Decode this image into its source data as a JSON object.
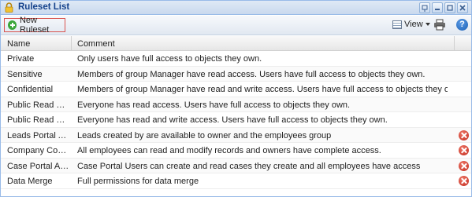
{
  "window": {
    "title": "Ruleset List"
  },
  "toolbar": {
    "new_label": "New Ruleset",
    "view_label": "View"
  },
  "grid": {
    "columns": [
      "Name",
      "Comment"
    ],
    "rows": [
      {
        "name": "Private",
        "comment": "Only users have full access to objects they own.",
        "deletable": false
      },
      {
        "name": "Sensitive",
        "comment": "Members of group Manager have read access. Users have full access to objects they own.",
        "deletable": false
      },
      {
        "name": "Confidential",
        "comment": "Members of group Manager have read and write access. Users have full access to objects they own.",
        "deletable": false
      },
      {
        "name": "Public Read Only",
        "comment": "Everyone has read access. Users have full access to objects they own.",
        "deletable": false
      },
      {
        "name": "Public Read Write",
        "comment": "Everyone has read and write access. Users have full access to objects they own.",
        "deletable": false
      },
      {
        "name": "Leads Portal Acc...",
        "comment": "Leads created by are available to owner and the employees group",
        "deletable": true
      },
      {
        "name": "Company Confid...",
        "comment": "All employees can read and modify records and owners have complete access.",
        "deletable": true
      },
      {
        "name": "Case Portal Acc...",
        "comment": "Case Portal Users can create and read cases they create and all employees have access",
        "deletable": true
      },
      {
        "name": "Data Merge",
        "comment": "Full permissions for data merge",
        "deletable": true
      }
    ]
  },
  "colors": {
    "accent": "#15428b",
    "highlight_border": "#d9534f",
    "delete": "#c0271a",
    "add": "#3aa63a"
  },
  "icons": {
    "title": "lock-icon",
    "new": "add-circle-icon",
    "view": "grid-view-icon",
    "print": "printer-icon",
    "help": "help-icon",
    "delete": "delete-icon"
  }
}
